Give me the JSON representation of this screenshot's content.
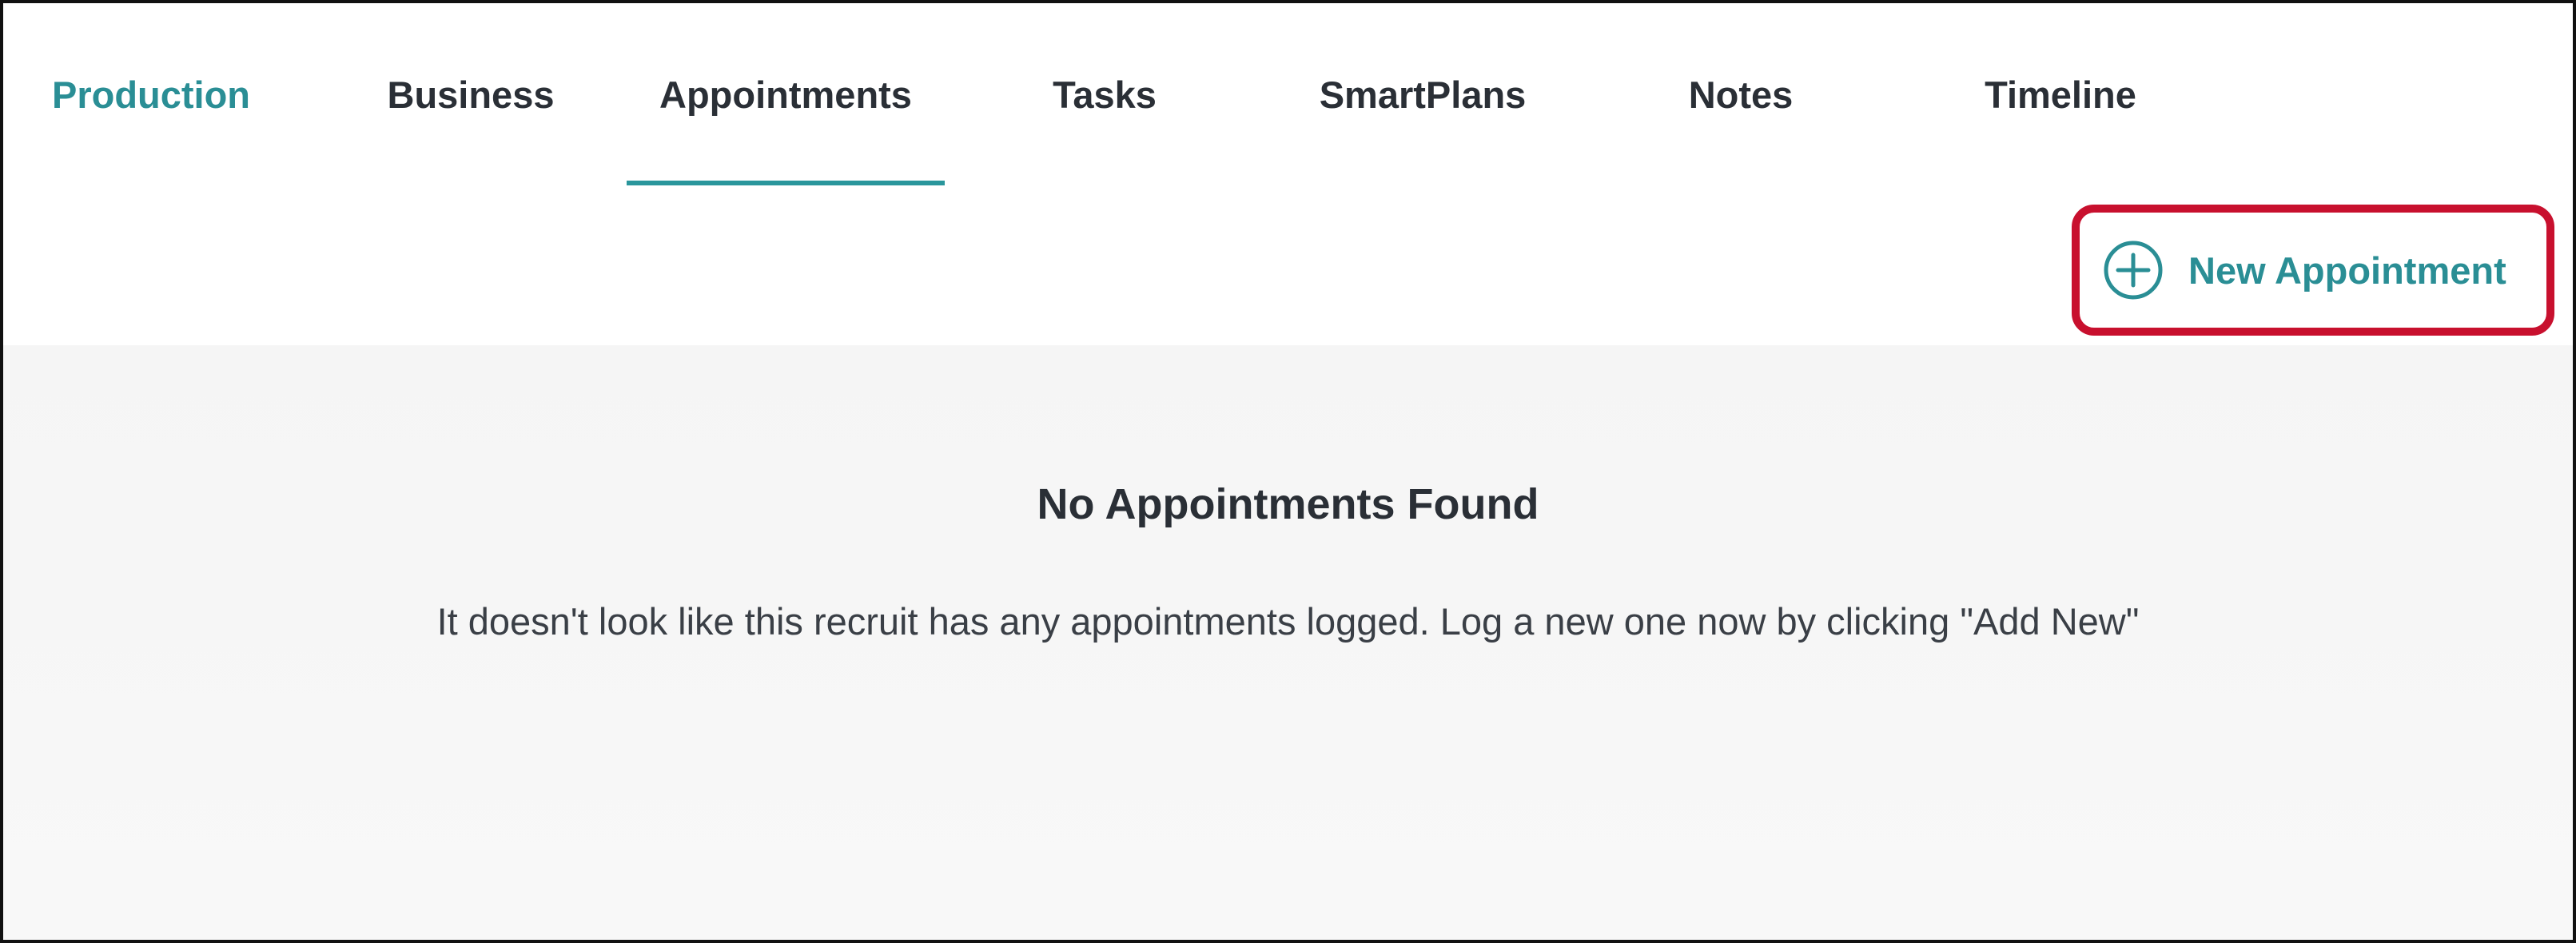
{
  "tabs": [
    {
      "label": "Production"
    },
    {
      "label": "Business"
    },
    {
      "label": "Appointments"
    },
    {
      "label": "Tasks"
    },
    {
      "label": "SmartPlans"
    },
    {
      "label": "Notes"
    },
    {
      "label": "Timeline"
    }
  ],
  "active_tab": "Appointments",
  "actions": {
    "new_appointment_label": "New Appointment",
    "new_appointment_icon": "plus-circle-icon"
  },
  "empty_state": {
    "title": "No Appointments Found",
    "message": "It doesn't look like this recruit has any appointments logged. Log a new one now by clicking \"Add New\""
  },
  "colors": {
    "accent": "#2a8e95",
    "underline": "#2a969c",
    "highlight_border": "#c8102e",
    "panel_bg": "#f6f6f6",
    "text": "#2a2f36"
  }
}
